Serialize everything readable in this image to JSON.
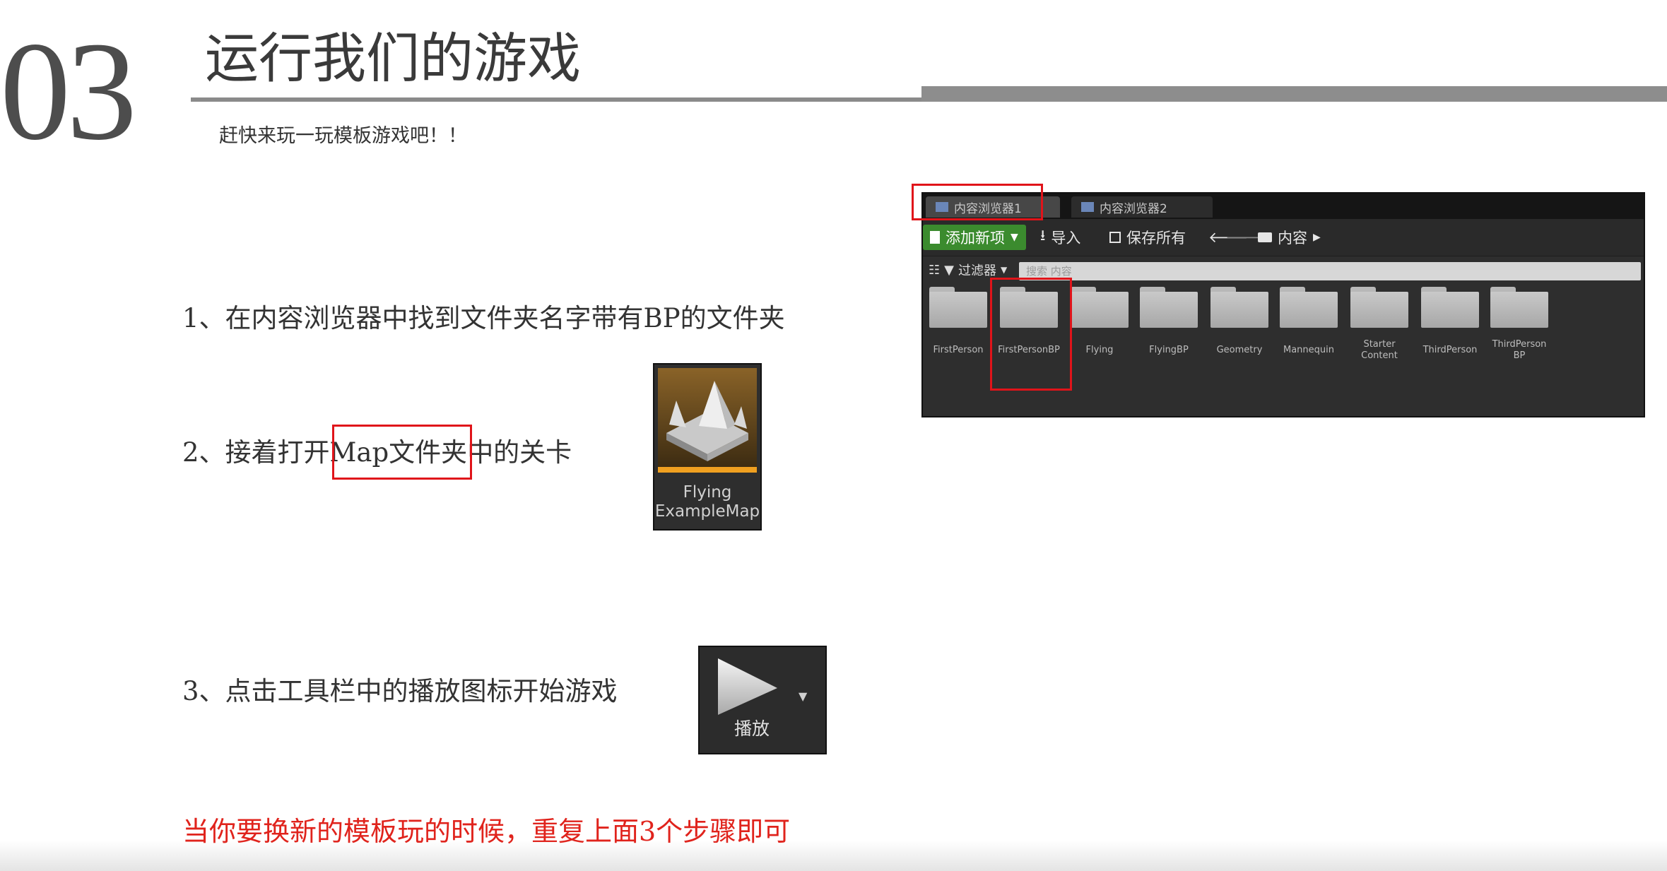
{
  "header": {
    "slide_number": "03",
    "title": "运行我们的游戏",
    "subtitle": "赶快来玩一玩模板游戏吧！！"
  },
  "steps": {
    "step1": "1、在内容浏览器中找到文件夹名字带有BP的文件夹",
    "step2_prefix": "2、接着打开",
    "step2_highlight": "Map文件夹",
    "step2_suffix": "中的关卡",
    "step3": "3、点击工具栏中的播放图标开始游戏"
  },
  "content_browser": {
    "tabs": [
      "内容浏览器1",
      "内容浏览器2"
    ],
    "add_new": "添加新项",
    "import": "导入",
    "save_all": "保存所有",
    "path": "内容",
    "filters": "过滤器",
    "search_placeholder": "搜索 内容",
    "folders": [
      "FirstPerson",
      "FirstPersonBP",
      "Flying",
      "FlyingBP",
      "Geometry",
      "Mannequin",
      "Starter Content",
      "ThirdPerson",
      "ThirdPerson BP"
    ]
  },
  "map_asset": {
    "label_line1": "Flying",
    "label_line2": "ExampleMap"
  },
  "play_button": {
    "label": "播放"
  },
  "footer_note": "当你要换新的模板玩的时候，重复上面3个步骤即可",
  "colors": {
    "accent_red": "#e0141a",
    "add_button_green": "#3b8b2e",
    "map_orange": "#f0a020"
  }
}
